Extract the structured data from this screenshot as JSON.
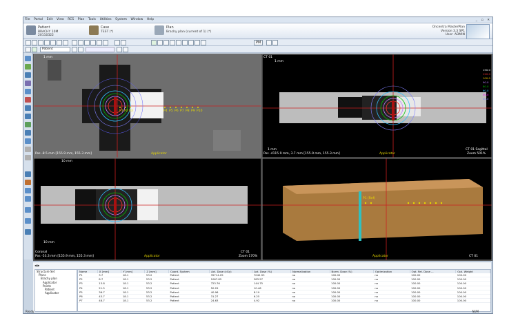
{
  "menu": [
    "File",
    "Portal",
    "Edit",
    "View",
    "RCS",
    "Plan",
    "Tools",
    "Utilities",
    "System",
    "Window",
    "Help"
  ],
  "header": {
    "patient_label": "Patient",
    "patient_name": "BRACHY 10M",
    "patient_id": "20110322",
    "case_label": "Case",
    "case_name": "TEST (*)",
    "plan_label": "Plan",
    "plan_name": "Brachy plan (current of 1) (*)",
    "product": "Oncentra MasterPlan",
    "version": "Version 3.3 SP1",
    "user": "User: ADMIN"
  },
  "toolbar2": {
    "patient_select": "Patient"
  },
  "toolbar_pill": "PM",
  "viewports": {
    "top_left": {
      "scale": "1 mm",
      "name": "Applicator",
      "info": "Pos -8.5 mm [155.9 mm, 155.3 mm]"
    },
    "top_right": {
      "scale": "1 mm",
      "name": "Applicator",
      "modality": "CT 01",
      "view": "CT 01 Sagittal",
      "info": "Pos -4115.9 mm, 3.7 mm [155.9 mm, 155.3 mm]",
      "zoom": "Zoom 501%",
      "scale2": "1 mm"
    },
    "bottom_left": {
      "scale": "10 mm",
      "name": "Applicator",
      "view": "Coronal",
      "info": "Pos -53.3 mm [155.9 mm, 155.3 mm]",
      "modality": "CT 01",
      "zoom": "Zoom 170%",
      "scale2": "10 mm"
    },
    "bottom_right": {
      "name": "Applicator",
      "modality": "CT 01",
      "point_label": "P1 (Ref)"
    }
  },
  "isodose_values": [
    "150.0",
    "120.0",
    "100.0",
    "90.0",
    "80.0",
    "60.0",
    "50.0",
    "40.0"
  ],
  "isodose_colors": [
    "#ffffff",
    "#ff3030",
    "#ffcc00",
    "#c080ff",
    "#00c000",
    "#30c0ff",
    "#ff00ff",
    "#8080ff"
  ],
  "points_axial": [
    "P1",
    "P2",
    "P3",
    "P4",
    "P5",
    "P6",
    "P7",
    "P8",
    "P9",
    "P10"
  ],
  "tree": [
    "Structure Set",
    "Plans",
    "Brachy plan",
    "Applicator",
    "Points",
    "Patient",
    "Applicator"
  ],
  "table": {
    "columns": [
      "Name",
      "X [mm]",
      "Y [mm]",
      "Z [mm]",
      "Coord. System",
      "Act. Dose (cGy)",
      "Act. Dose (%)",
      "Normalization",
      "Norm. Dose (%)",
      "Optimization",
      "Opt. Rel. Dose ...",
      "Opt. Weight"
    ],
    "rows": [
      [
        "P1",
        "3.7",
        "18.1",
        "53.2",
        "Patient",
        "35714.05",
        "7042.93",
        "no",
        "100.00",
        "no",
        "100.00",
        "100.00"
      ],
      [
        "P2",
        "8.7",
        "18.1",
        "53.2",
        "Patient",
        "1067.85",
        "283.57",
        "no",
        "100.00",
        "no",
        "100.00",
        "100.00"
      ],
      [
        "P3",
        "13.8",
        "18.1",
        "53.2",
        "Patient",
        "723.76",
        "144.75",
        "no",
        "100.00",
        "no",
        "100.00",
        "100.00"
      ],
      [
        "P4",
        "21.5",
        "18.1",
        "53.2",
        "Patient",
        "50.29",
        "10.46",
        "no",
        "100.00",
        "no",
        "100.00",
        "100.00"
      ],
      [
        "P5",
        "36.7",
        "18.1",
        "53.2",
        "Patient",
        "40.96",
        "8.19",
        "no",
        "100.00",
        "no",
        "100.00",
        "100.00"
      ],
      [
        "P6",
        "43.7",
        "18.1",
        "53.2",
        "Patient",
        "31.27",
        "6.25",
        "no",
        "100.00",
        "no",
        "100.00",
        "100.00"
      ],
      [
        "P7",
        "48.7",
        "18.1",
        "53.2",
        "Patient",
        "24.63",
        "4.92",
        "no",
        "100.00",
        "no",
        "100.00",
        "100.00"
      ]
    ]
  },
  "status": {
    "left": "Ready",
    "right": "NUM"
  }
}
